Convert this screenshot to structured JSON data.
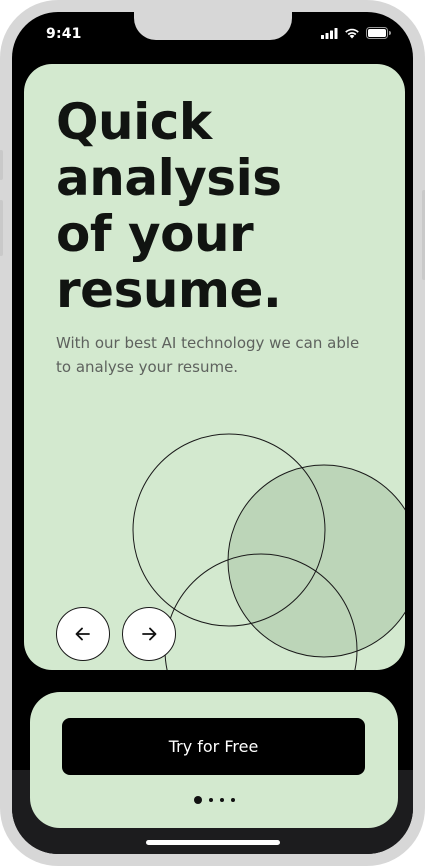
{
  "status_bar": {
    "time": "9:41",
    "icons": [
      "cellular-signal-icon",
      "wifi-icon",
      "battery-icon"
    ]
  },
  "hero": {
    "title": "Quick\nanalysis\nof your\nresume.",
    "subtitle": "With our best AI technology we can able to analyse your resume.",
    "background_color": "#d3e9cf"
  },
  "carousel": {
    "prev_icon": "arrow-left-icon",
    "next_icon": "arrow-right-icon",
    "page_count": 4,
    "active_page": 1
  },
  "cta": {
    "label": "Try for Free",
    "button_color": "#000000"
  },
  "colors": {
    "accent_green": "#d3e9cf",
    "decor_fill": "#bcd5b8"
  }
}
